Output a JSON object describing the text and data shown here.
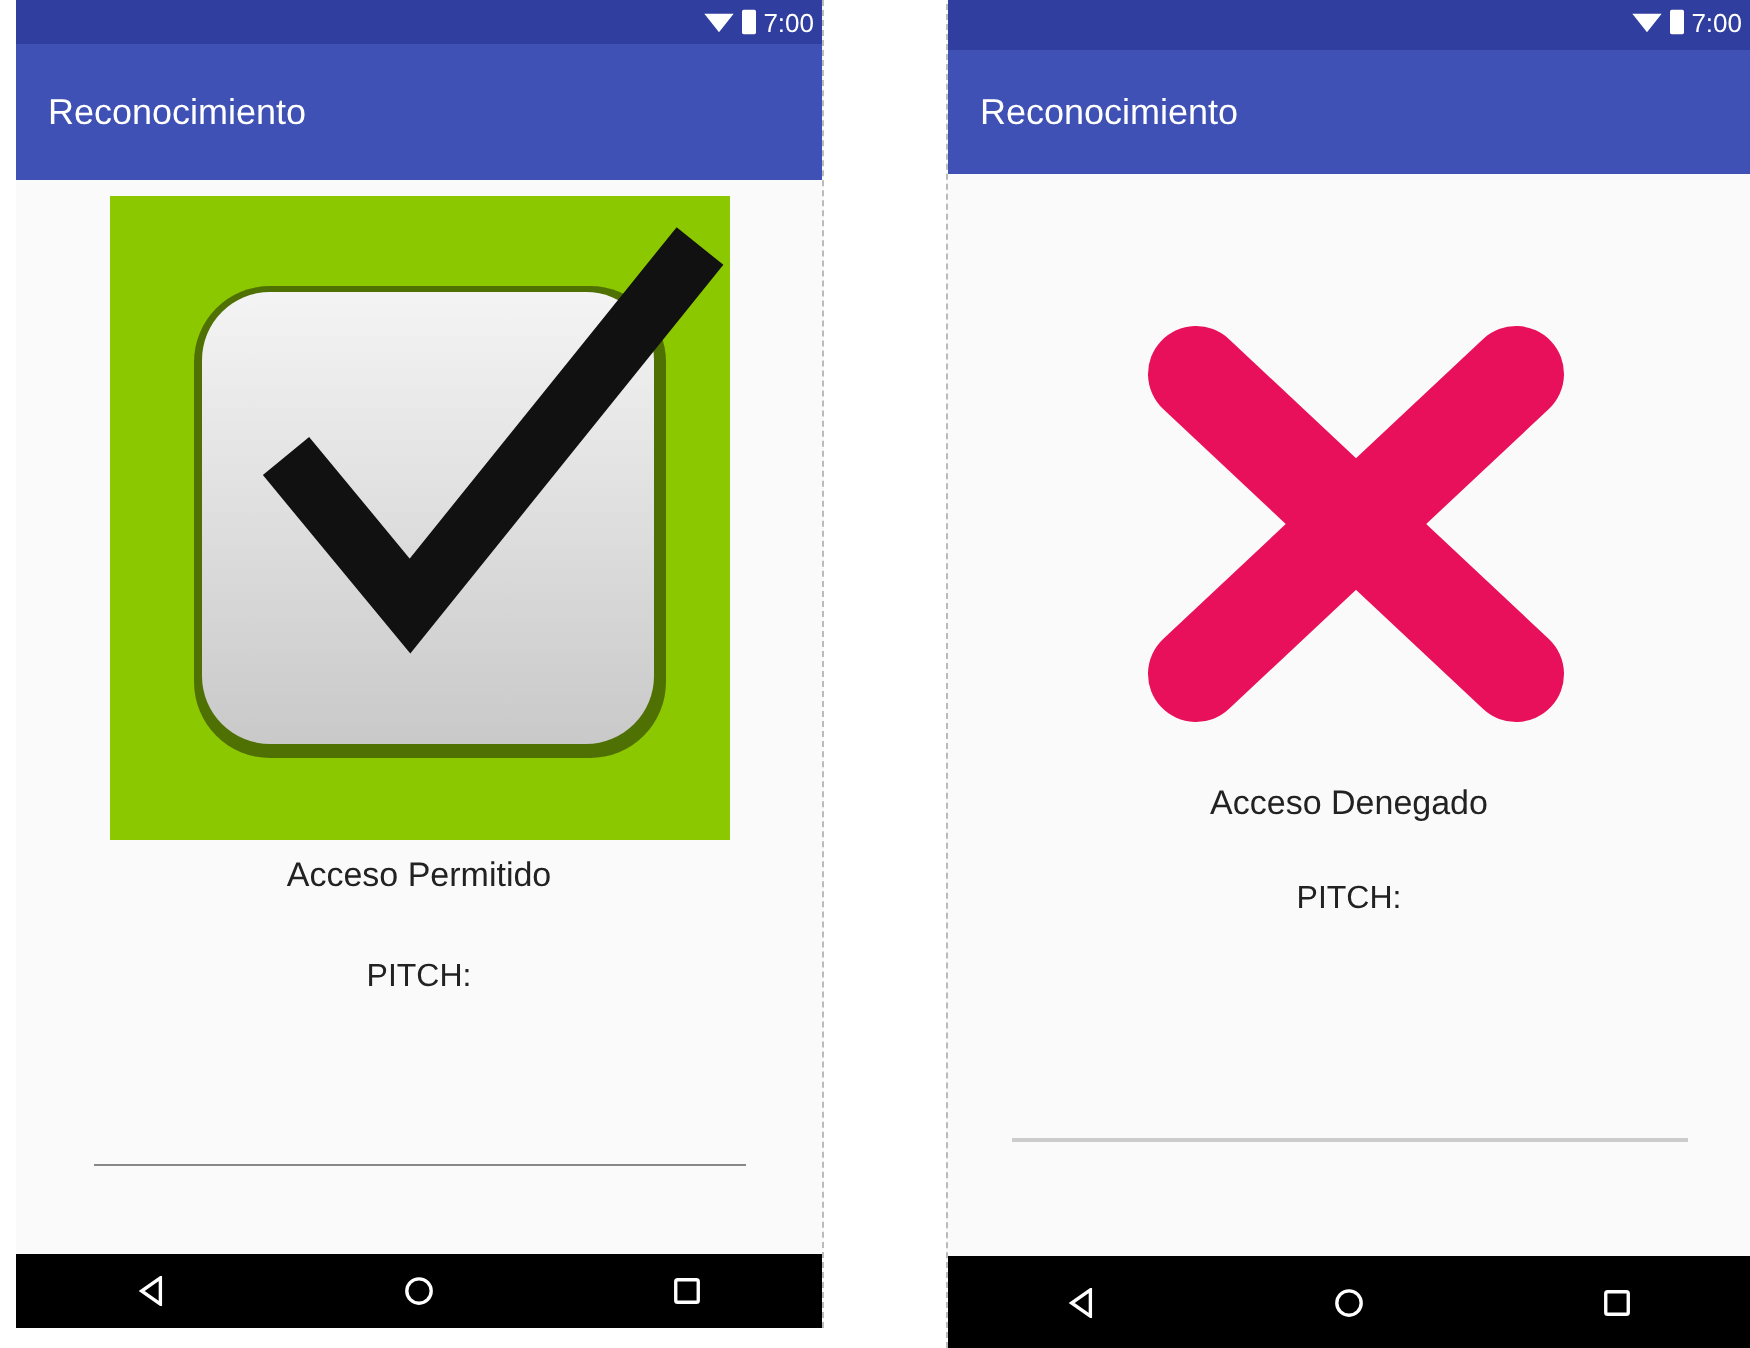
{
  "screens": [
    {
      "status_time": "7:00",
      "title": "Reconocimiento",
      "kind": "granted",
      "result_text": "Acceso Permitido",
      "pitch_label": "PITCH:"
    },
    {
      "status_time": "7:00",
      "title": "Reconocimiento",
      "kind": "denied",
      "result_text": "Acceso Denegado",
      "pitch_label": "PITCH:"
    }
  ]
}
